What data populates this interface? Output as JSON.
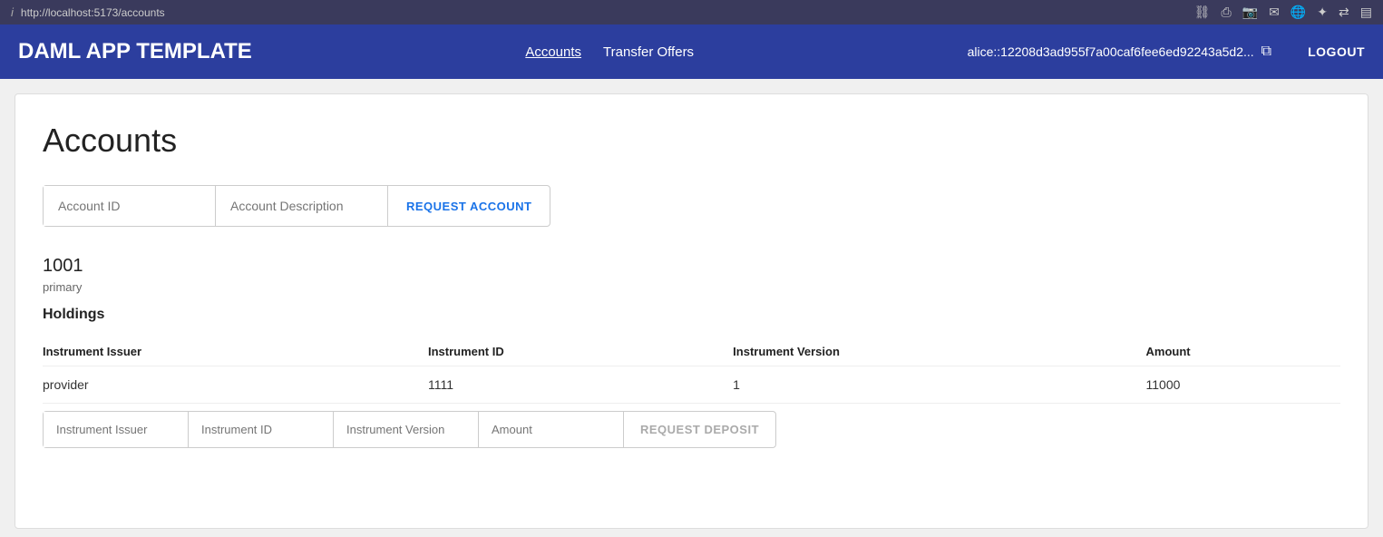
{
  "browser": {
    "url": "http://localhost:5173/accounts",
    "info_icon": "i"
  },
  "header": {
    "app_title": "DAML APP TEMPLATE",
    "nav": [
      {
        "label": "Accounts",
        "active": true,
        "href": "/accounts"
      },
      {
        "label": "Transfer Offers",
        "active": false,
        "href": "/transfer-offers"
      }
    ],
    "user_id": "alice::12208d3ad955f7a00caf6fee6ed92243a5d2...",
    "logout_label": "LOGOUT"
  },
  "page": {
    "title": "Accounts"
  },
  "account_form": {
    "account_id_placeholder": "Account ID",
    "account_description_placeholder": "Account Description",
    "request_button_label": "REQUEST ACCOUNT"
  },
  "accounts": [
    {
      "id": "1001",
      "description": "primary",
      "holdings_title": "Holdings",
      "table": {
        "columns": [
          "Instrument Issuer",
          "Instrument ID",
          "Instrument Version",
          "Amount"
        ],
        "rows": [
          {
            "instrument_issuer": "provider",
            "instrument_id": "1111",
            "instrument_version": "1",
            "amount": "11000"
          }
        ]
      },
      "deposit_form": {
        "instrument_issuer_placeholder": "Instrument Issuer",
        "instrument_id_placeholder": "Instrument ID",
        "instrument_version_placeholder": "Instrument Version",
        "amount_placeholder": "Amount",
        "request_button_label": "REQUEST DEPOSIT"
      }
    }
  ]
}
